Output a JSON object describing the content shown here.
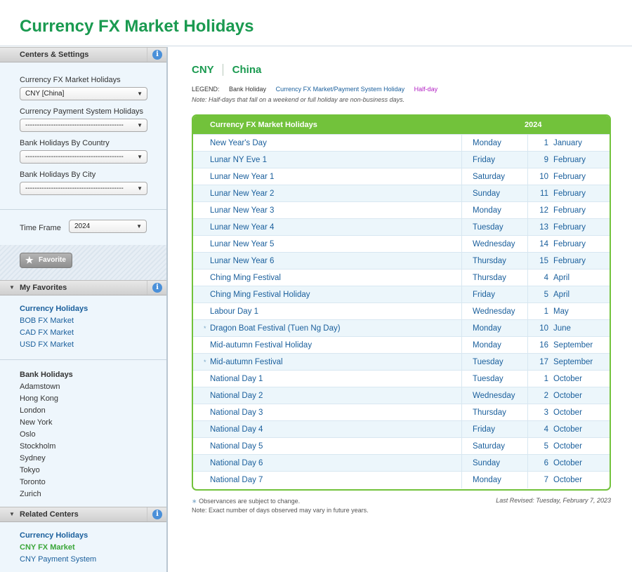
{
  "page_title": "Currency FX Market Holidays",
  "sidebar": {
    "centers_settings": {
      "title": "Centers & Settings",
      "fx_label": "Currency FX Market Holidays",
      "fx_value": "CNY [China]",
      "payment_label": "Currency Payment System Holidays",
      "payment_value": "------------------------------------------",
      "bank_country_label": "Bank Holidays By Country",
      "bank_country_value": "------------------------------------------",
      "bank_city_label": "Bank Holidays By City",
      "bank_city_value": "------------------------------------------",
      "timeframe_label": "Time Frame",
      "timeframe_value": "2024",
      "favorite_label": "Favorite"
    },
    "my_favorites": {
      "title": "My Favorites",
      "currency_heading": "Currency Holidays",
      "currency_items": [
        "BOB FX Market",
        "CAD FX Market",
        "USD FX Market"
      ],
      "bank_heading": "Bank Holidays",
      "bank_items": [
        "Adamstown",
        "Hong Kong",
        "London",
        "New York",
        "Oslo",
        "Stockholm",
        "Sydney",
        "Tokyo",
        "Toronto",
        "Zurich"
      ]
    },
    "related_centers": {
      "title": "Related Centers",
      "currency_heading": "Currency Holidays",
      "items": [
        "CNY FX Market",
        "CNY Payment System"
      ]
    }
  },
  "main": {
    "currency_code": "CNY",
    "currency_name": "China",
    "legend": {
      "label": "LEGEND:",
      "bank": "Bank Holiday",
      "fx": "Currency FX Market/Payment System Holiday",
      "half": "Half-day",
      "note": "Note: Half-days that fall on a weekend or full holiday are non-business days."
    },
    "table": {
      "header_name": "Currency FX Market Holidays",
      "header_year": "2024",
      "rows": [
        {
          "name": "New Year's Day",
          "star": "",
          "day": "Monday",
          "num": "1",
          "month": "January"
        },
        {
          "name": "Lunar NY Eve 1",
          "star": "",
          "day": "Friday",
          "num": "9",
          "month": "February"
        },
        {
          "name": "Lunar New Year 1",
          "star": "",
          "day": "Saturday",
          "num": "10",
          "month": "February"
        },
        {
          "name": "Lunar New Year 2",
          "star": "",
          "day": "Sunday",
          "num": "11",
          "month": "February"
        },
        {
          "name": "Lunar New Year 3",
          "star": "",
          "day": "Monday",
          "num": "12",
          "month": "February"
        },
        {
          "name": "Lunar New Year 4",
          "star": "",
          "day": "Tuesday",
          "num": "13",
          "month": "February"
        },
        {
          "name": "Lunar New Year 5",
          "star": "",
          "day": "Wednesday",
          "num": "14",
          "month": "February"
        },
        {
          "name": "Lunar New Year 6",
          "star": "",
          "day": "Thursday",
          "num": "15",
          "month": "February"
        },
        {
          "name": "Ching Ming Festival",
          "star": "",
          "day": "Thursday",
          "num": "4",
          "month": "April"
        },
        {
          "name": "Ching Ming Festival Holiday",
          "star": "",
          "day": "Friday",
          "num": "5",
          "month": "April"
        },
        {
          "name": "Labour Day 1",
          "star": "",
          "day": "Wednesday",
          "num": "1",
          "month": "May"
        },
        {
          "name": "Dragon Boat Festival (Tuen Ng Day)",
          "star": "*",
          "day": "Monday",
          "num": "10",
          "month": "June"
        },
        {
          "name": "Mid-autumn Festival Holiday",
          "star": "",
          "day": "Monday",
          "num": "16",
          "month": "September"
        },
        {
          "name": "Mid-autumn Festival",
          "star": "*",
          "day": "Tuesday",
          "num": "17",
          "month": "September"
        },
        {
          "name": "National Day 1",
          "star": "",
          "day": "Tuesday",
          "num": "1",
          "month": "October"
        },
        {
          "name": "National Day 2",
          "star": "",
          "day": "Wednesday",
          "num": "2",
          "month": "October"
        },
        {
          "name": "National Day 3",
          "star": "",
          "day": "Thursday",
          "num": "3",
          "month": "October"
        },
        {
          "name": "National Day 4",
          "star": "",
          "day": "Friday",
          "num": "4",
          "month": "October"
        },
        {
          "name": "National Day 5",
          "star": "",
          "day": "Saturday",
          "num": "5",
          "month": "October"
        },
        {
          "name": "National Day 6",
          "star": "",
          "day": "Sunday",
          "num": "6",
          "month": "October"
        },
        {
          "name": "National Day 7",
          "star": "",
          "day": "Monday",
          "num": "7",
          "month": "October"
        }
      ]
    },
    "footnote_star": "∗",
    "footnote_1": "Observances are subject to change.",
    "footnote_2": "Note: Exact number of days observed may vary in future years.",
    "last_revised": "Last Revised:  Tuesday, February 7, 2023"
  },
  "colors": {
    "brand_green": "#1a9a50",
    "table_green": "#72c23b",
    "link_blue": "#1a5f9c",
    "half_day_purple": "#b21fc3"
  },
  "icons": [
    "info-icon",
    "star-icon",
    "chevron-down-icon",
    "triangle-down-icon"
  ]
}
